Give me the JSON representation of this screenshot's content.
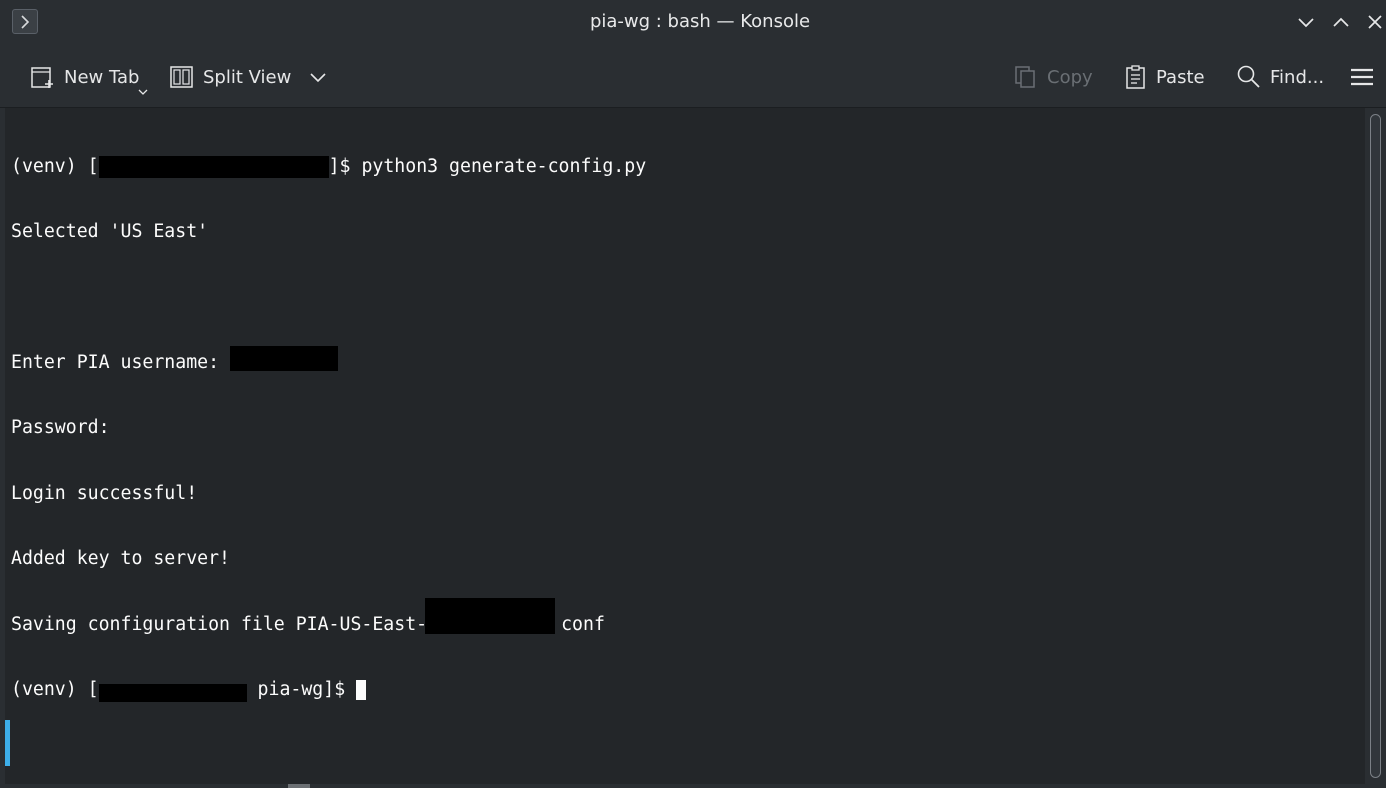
{
  "window": {
    "title": "pia-wg : bash — Konsole"
  },
  "toolbar": {
    "new_tab": "New Tab",
    "split_view": "Split View",
    "copy": "Copy",
    "paste": "Paste",
    "find": "Find..."
  },
  "terminal": {
    "line1_prefix": "(venv) [",
    "line1_suffix": "]$ python3 generate-config.py",
    "line2": "Selected 'US East'",
    "line3": "",
    "line4": "Enter PIA username: ",
    "line5": "Password:",
    "line6": "Login successful!",
    "line7": "Added key to server!",
    "line8_prefix": "Saving configuration file PIA-US-East-",
    "line8_suffix": "conf",
    "line9_prefix": "(venv) [",
    "line9_suffix": " pia-wg]$ "
  },
  "colors": {
    "background": "#2a2e32",
    "terminal_bg": "#232629",
    "terminal_fg": "#fcfcfc",
    "accent": "#3daee9"
  }
}
